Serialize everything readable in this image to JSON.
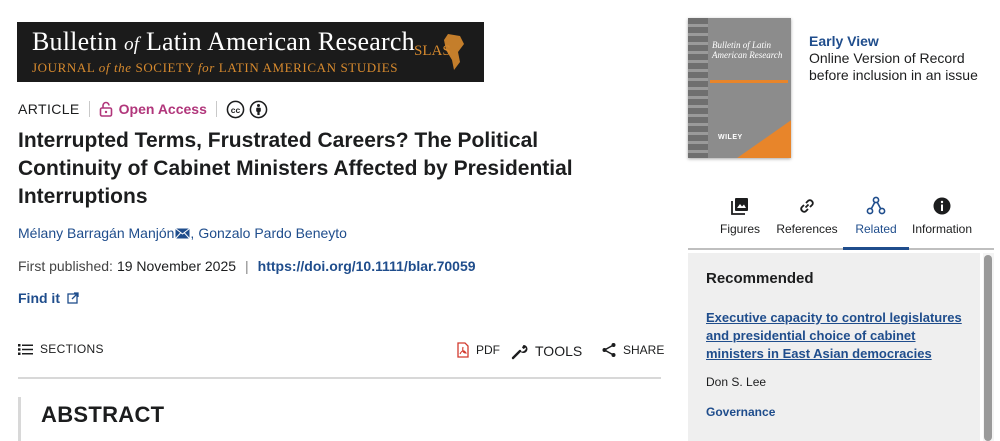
{
  "journal": {
    "banner_title_parts": [
      "Bulletin ",
      "of",
      " Latin American Research"
    ],
    "banner_subtitle_parts": [
      "JOURNAL ",
      "of the",
      " SOCIETY ",
      "for",
      " LATIN AMERICAN STUDIES"
    ],
    "logo_text": "SLAS"
  },
  "article": {
    "type": "ARTICLE",
    "access": "Open Access",
    "title": "Interrupted Terms, Frustrated Careers? The Political Continuity of Cabinet Ministers Affected by Presidential Interruptions",
    "authors": [
      "Mélany Barragán Manjón",
      "Gonzalo Pardo Beneyto"
    ],
    "first_published_label": "First published:",
    "first_published_date": "19 November 2025",
    "doi": "https://doi.org/10.1111/blar.70059",
    "find_it": "Find it"
  },
  "toolbar": {
    "sections": "SECTIONS",
    "pdf": "PDF",
    "tools": "TOOLS",
    "share": "SHARE"
  },
  "abstract": {
    "heading": "ABSTRACT"
  },
  "sidebar": {
    "cover_title": "Bulletin of Latin American Research",
    "cover_publisher": "WILEY",
    "early_view_title": "Early View",
    "early_view_desc": "Online Version of Record before inclusion in an issue",
    "tabs": [
      {
        "label": "Figures",
        "icon": "image-icon",
        "active": false
      },
      {
        "label": "References",
        "icon": "link-icon",
        "active": false
      },
      {
        "label": "Related",
        "icon": "network-icon",
        "active": true
      },
      {
        "label": "Information",
        "icon": "info-icon",
        "active": false
      }
    ],
    "recommended": {
      "heading": "Recommended",
      "item_title": "Executive capacity to control legislatures and presidential choice of cabinet ministers in East Asian democracies",
      "item_author": "Don S. Lee",
      "item_journal": "Governance"
    }
  },
  "colors": {
    "link_blue": "#1f4d8c",
    "open_access_magenta": "#b1367b",
    "banner_orange": "#d78a2e"
  }
}
